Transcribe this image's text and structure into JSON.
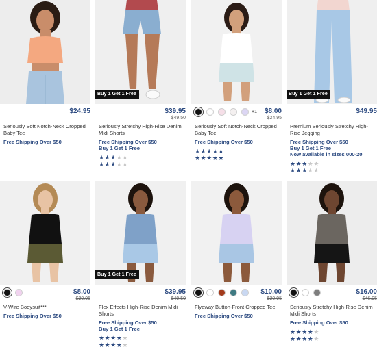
{
  "products": [
    {
      "name": "Seriously Soft Notch-Neck Cropped Baby Tee",
      "price": "$24.95",
      "original_price": "",
      "promo_tag": "",
      "swatches": [],
      "more_swatches": "",
      "messages": [
        "Free Shipping Over $50"
      ],
      "ratings": []
    },
    {
      "name": "Seriously Stretchy High-Rise Denim Midi Shorts",
      "price": "$39.95",
      "original_price": "$49.50",
      "promo_tag": "Buy 1 Get 1 Free",
      "swatches": [],
      "more_swatches": "",
      "messages": [
        "Free Shipping Over $50",
        "Buy 1 Get 1 Free"
      ],
      "ratings": [
        3,
        3
      ]
    },
    {
      "name": "Seriously Soft Notch-Neck Cropped Baby Tee",
      "price": "$8.00",
      "original_price": "$24.95",
      "promo_tag": "",
      "swatches": [
        "#111111",
        "#ffffff",
        "#f6dfe8",
        "#f4f0f0",
        "#dcd6f4"
      ],
      "more_swatches": "+1",
      "messages": [
        "Free Shipping Over $50"
      ],
      "ratings": [
        5,
        5
      ]
    },
    {
      "name": "Premium Seriously Stretchy High-Rise Jegging",
      "price": "$49.95",
      "original_price": "",
      "promo_tag": "Buy 1 Get 1 Free",
      "swatches": [],
      "more_swatches": "",
      "messages": [
        "Free Shipping Over $50",
        "Buy 1 Get 1 Free",
        "Now available in sizes 000-20"
      ],
      "ratings": [
        3,
        3
      ]
    },
    {
      "name": "V-Wire Bodysuit***",
      "price": "$8.00",
      "original_price": "$29.95",
      "promo_tag": "",
      "swatches": [
        "#111111",
        "#f1d3ef"
      ],
      "more_swatches": "",
      "messages": [
        "Free Shipping Over $50"
      ],
      "ratings": []
    },
    {
      "name": "Flex Effects High-Rise Denim Midi Shorts",
      "price": "$39.95",
      "original_price": "$49.50",
      "promo_tag": "Buy 1 Get 1 Free",
      "swatches": [],
      "more_swatches": "",
      "messages": [
        "Free Shipping Over $50",
        "Buy 1 Get 1 Free"
      ],
      "ratings": [
        4,
        4
      ]
    },
    {
      "name": "Flyaway Button-Front Cropped Tee",
      "price": "$10.00",
      "original_price": "$29.95",
      "promo_tag": "",
      "swatches": [
        "#111111",
        "#ffffff",
        "#a33b1c",
        "#3f7a82",
        "#c9d8f2"
      ],
      "more_swatches": "",
      "messages": [
        "Free Shipping Over $50"
      ],
      "ratings": []
    },
    {
      "name": "Seriously Stretchy High-Rise Denim Midi Shorts",
      "price": "$16.00",
      "original_price": "$46.95",
      "promo_tag": "",
      "swatches": [
        "#111111",
        "#ffffff",
        "#7d7d7d"
      ],
      "more_swatches": "",
      "messages": [
        "Free Shipping Over $50"
      ],
      "ratings": [
        4,
        4
      ]
    }
  ],
  "colors": {
    "accent": "#2c4a80",
    "star_off": "#c8c8c8",
    "promo_bg": "#111111"
  }
}
